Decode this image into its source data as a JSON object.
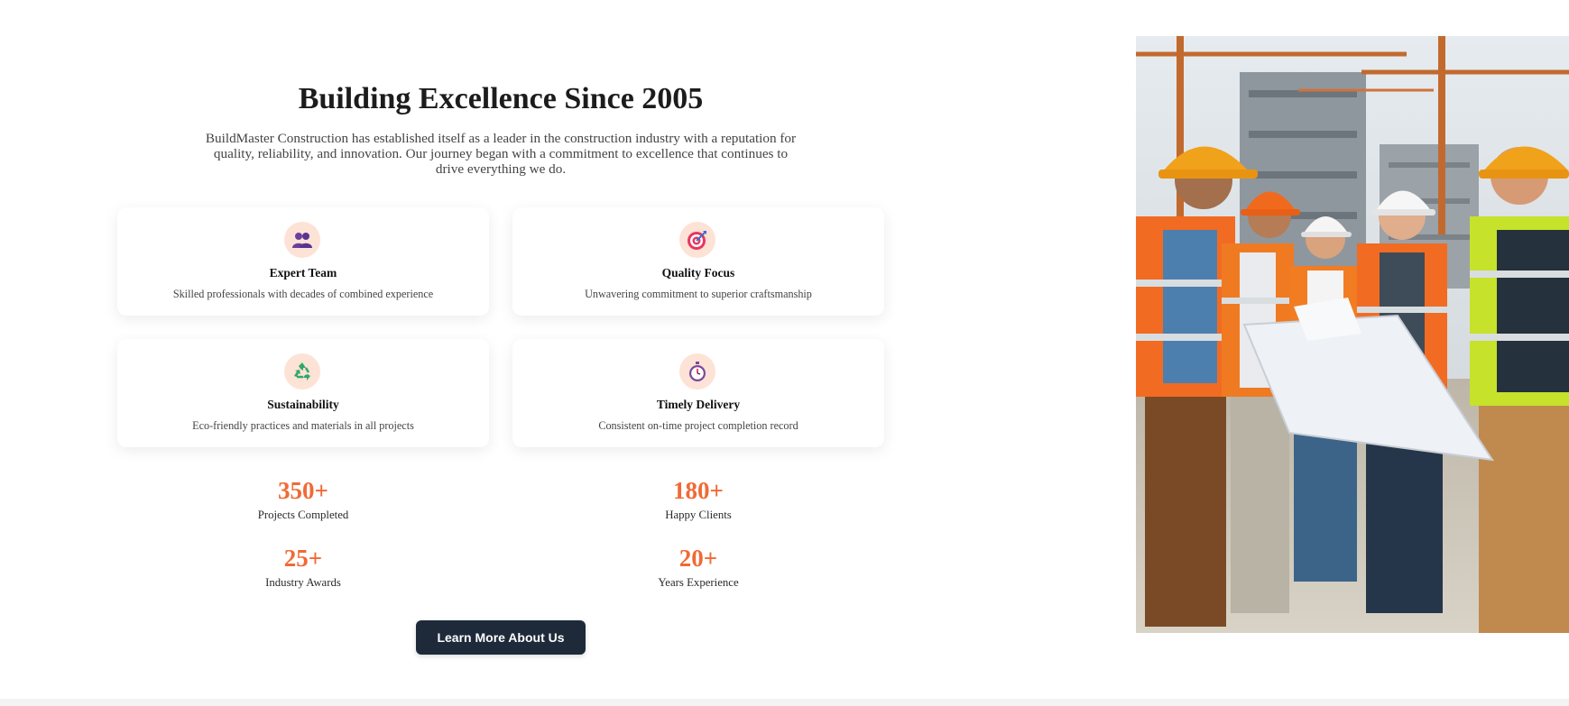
{
  "about": {
    "title": "Building Excellence Since 2005",
    "intro": "BuildMaster Construction has established itself as a leader in the construction industry with a reputation for quality, reliability, and innovation. Our journey began with a commitment to excellence that continues to drive everything we do.",
    "features": [
      {
        "icon": "team-icon",
        "title": "Expert Team",
        "description": "Skilled professionals with decades of combined experience"
      },
      {
        "icon": "target-icon",
        "title": "Quality Focus",
        "description": "Unwavering commitment to superior craftsmanship"
      },
      {
        "icon": "recycle-icon",
        "title": "Sustainability",
        "description": "Eco-friendly practices and materials in all projects"
      },
      {
        "icon": "stopwatch-icon",
        "title": "Timely Delivery",
        "description": "Consistent on-time project completion record"
      }
    ],
    "stats": [
      {
        "value": "350+",
        "label": "Projects Completed"
      },
      {
        "value": "180+",
        "label": "Happy Clients"
      },
      {
        "value": "25+",
        "label": "Industry Awards"
      },
      {
        "value": "20+",
        "label": "Years Experience"
      }
    ],
    "cta_label": "Learn More About Us"
  },
  "colors": {
    "accent": "#f06a35",
    "button": "#1e2a3a",
    "icon_bg": "#fde2d6"
  }
}
